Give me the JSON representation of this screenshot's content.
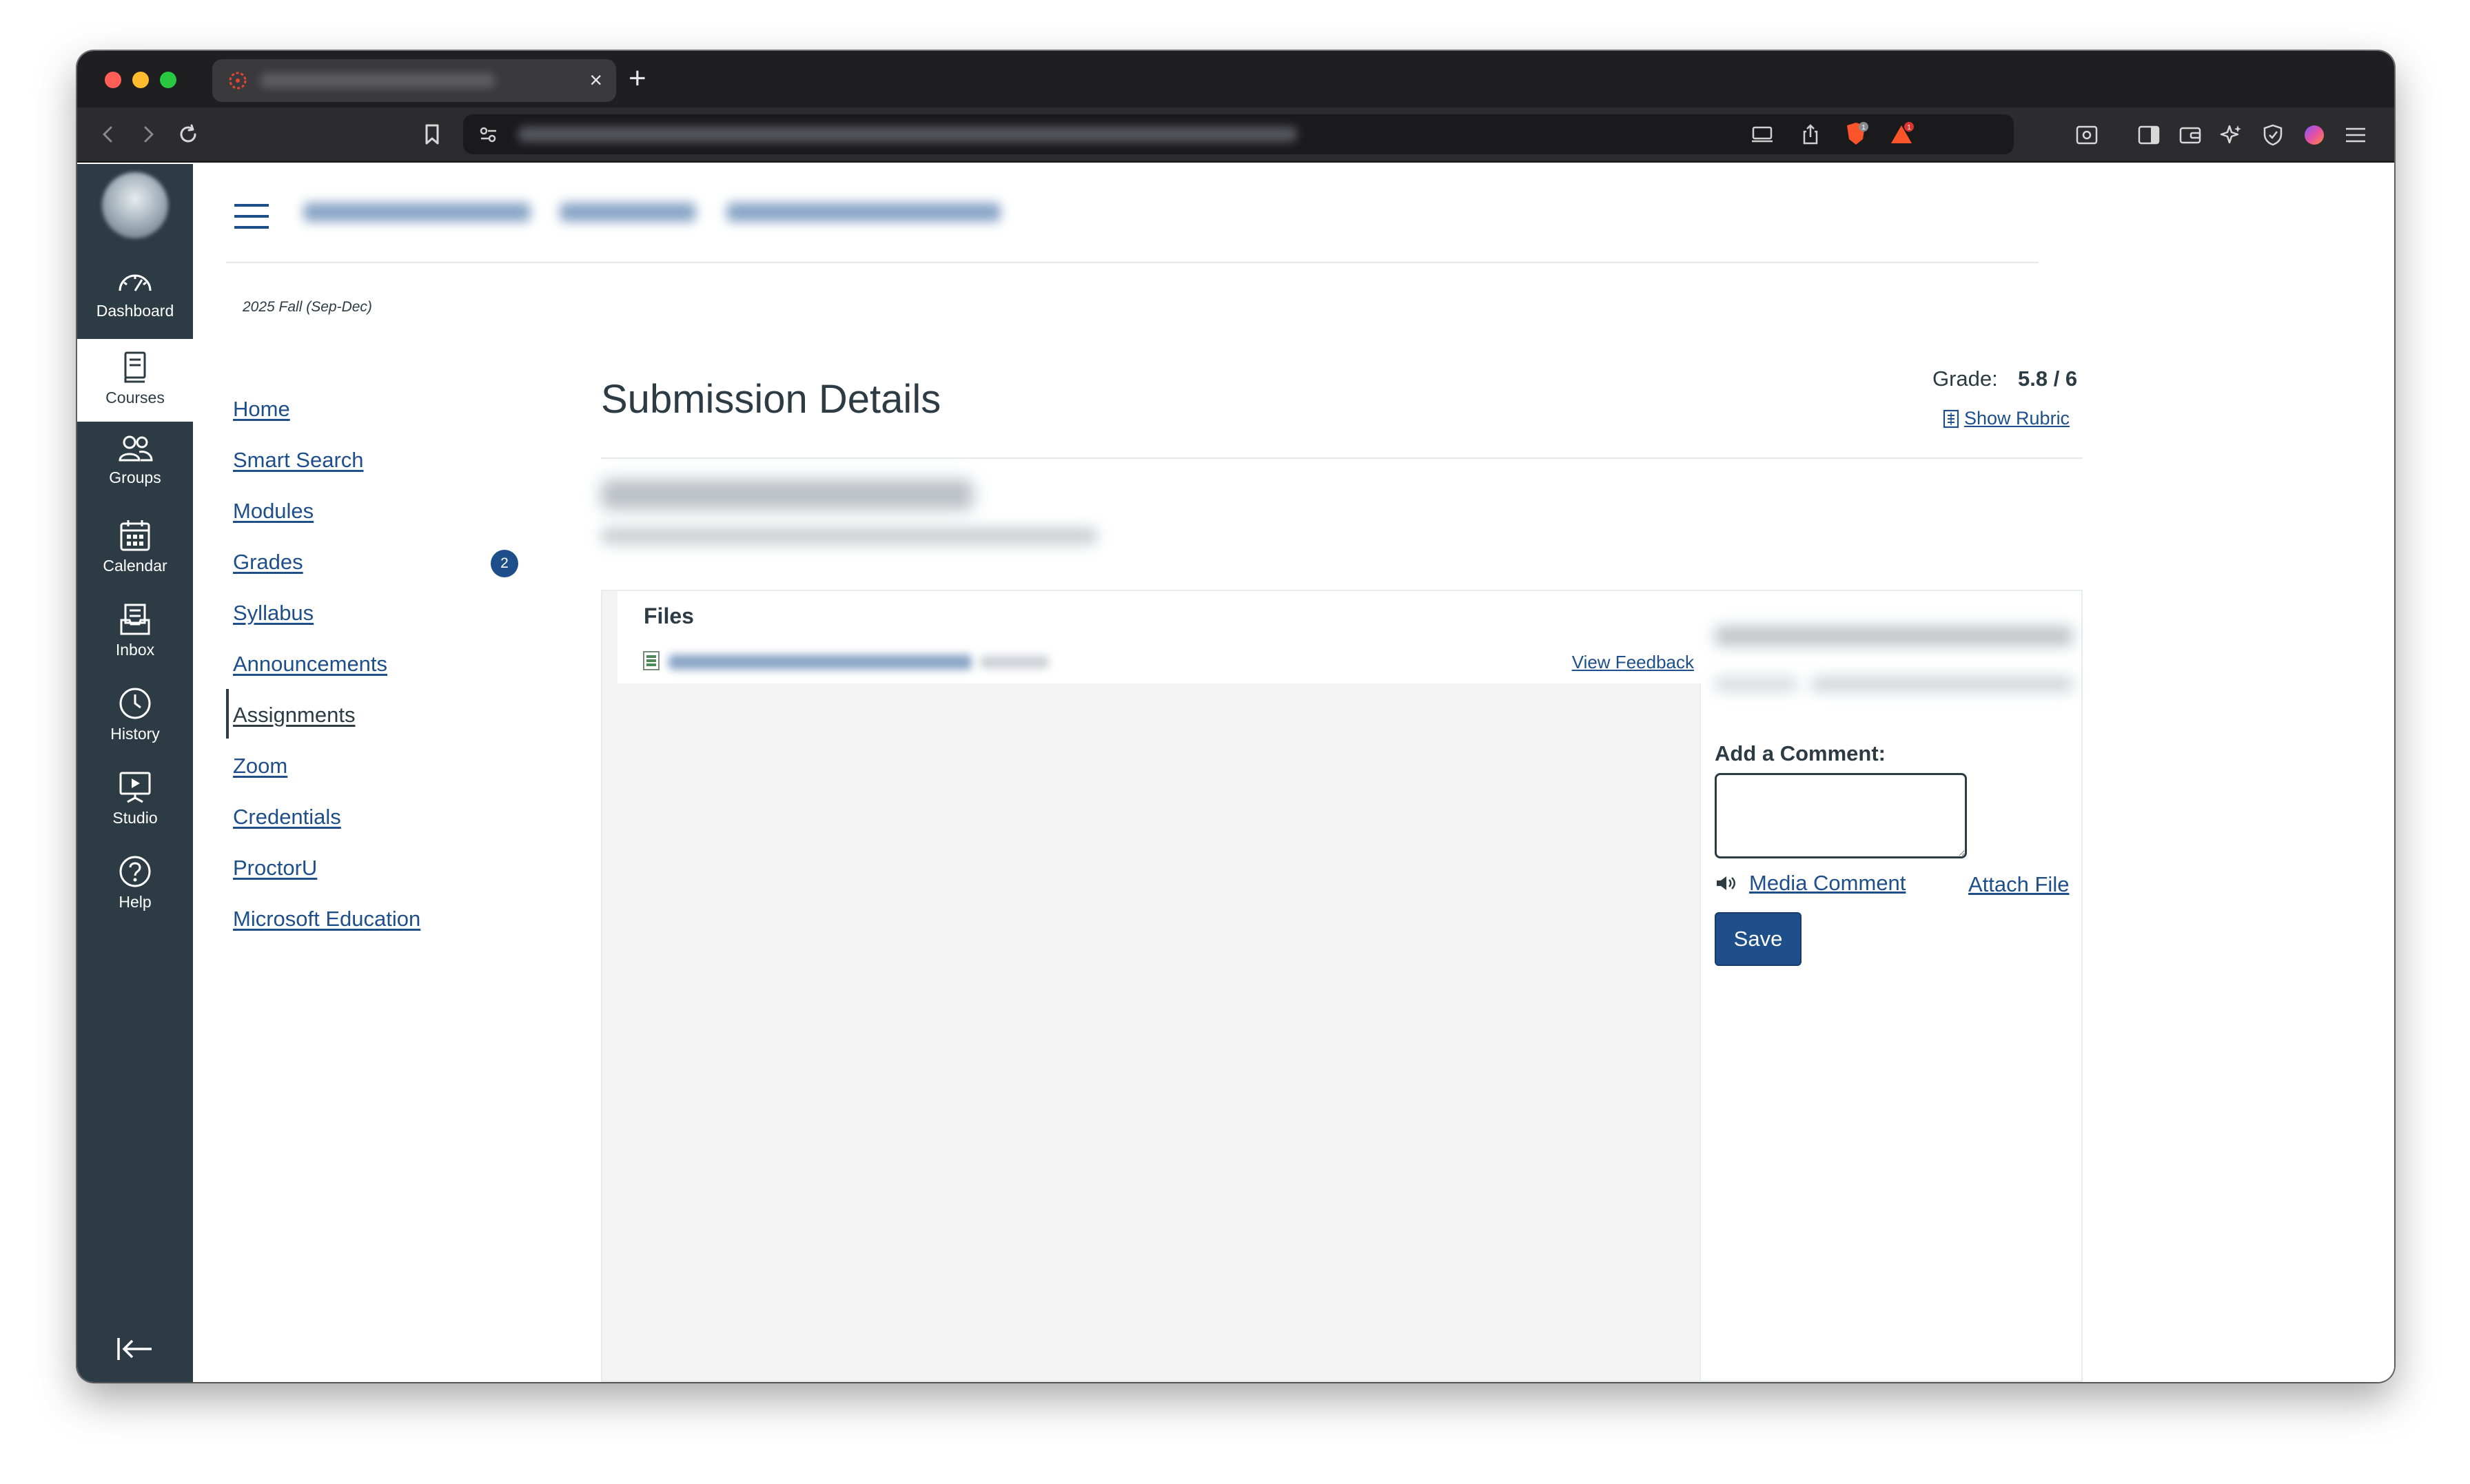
{
  "colors": {
    "nav_bg": "#2d3b45",
    "link": "#1e4f8a",
    "primary_button": "#1e4f8a",
    "badge": "#1e4f8a",
    "text": "#2d3b45"
  },
  "browser": {
    "tab_close": "×",
    "new_tab": "+",
    "icons": [
      "back-icon",
      "forward-icon",
      "reload-icon",
      "bookmark-icon",
      "site-settings-icon",
      "cast-icon",
      "share-icon",
      "brave-shield-icon",
      "brave-rewards-icon",
      "reader-mode-icon",
      "sidebar-icon",
      "wallet-icon",
      "leo-ai-icon",
      "vpn-icon",
      "profile-icon",
      "menu-icon"
    ],
    "shield_count": "1",
    "rewards_count": "1"
  },
  "global_nav": {
    "items": [
      {
        "label": "Dashboard",
        "icon": "dashboard-icon"
      },
      {
        "label": "Courses",
        "icon": "courses-icon"
      },
      {
        "label": "Groups",
        "icon": "groups-icon"
      },
      {
        "label": "Calendar",
        "icon": "calendar-icon"
      },
      {
        "label": "Inbox",
        "icon": "inbox-icon"
      },
      {
        "label": "History",
        "icon": "history-icon"
      },
      {
        "label": "Studio",
        "icon": "studio-icon"
      },
      {
        "label": "Help",
        "icon": "help-icon"
      }
    ],
    "active": "Courses"
  },
  "course_nav": {
    "term": "2025 Fall (Sep-Dec)",
    "items": [
      "Home",
      "Smart Search",
      "Modules",
      "Grades",
      "Syllabus",
      "Announcements",
      "Assignments",
      "Zoom",
      "Credentials",
      "ProctorU",
      "Microsoft Education"
    ],
    "active": "Assignments",
    "grades_badge": "2"
  },
  "submission": {
    "title": "Submission Details",
    "grade_label": "Grade:",
    "grade_value": "5.8 / 6",
    "show_rubric": "Show Rubric",
    "files_title": "Files",
    "view_feedback": "View Feedback",
    "add_comment_label": "Add a Comment:",
    "media_comment": "Media Comment",
    "attach_file": "Attach File",
    "save": "Save"
  }
}
